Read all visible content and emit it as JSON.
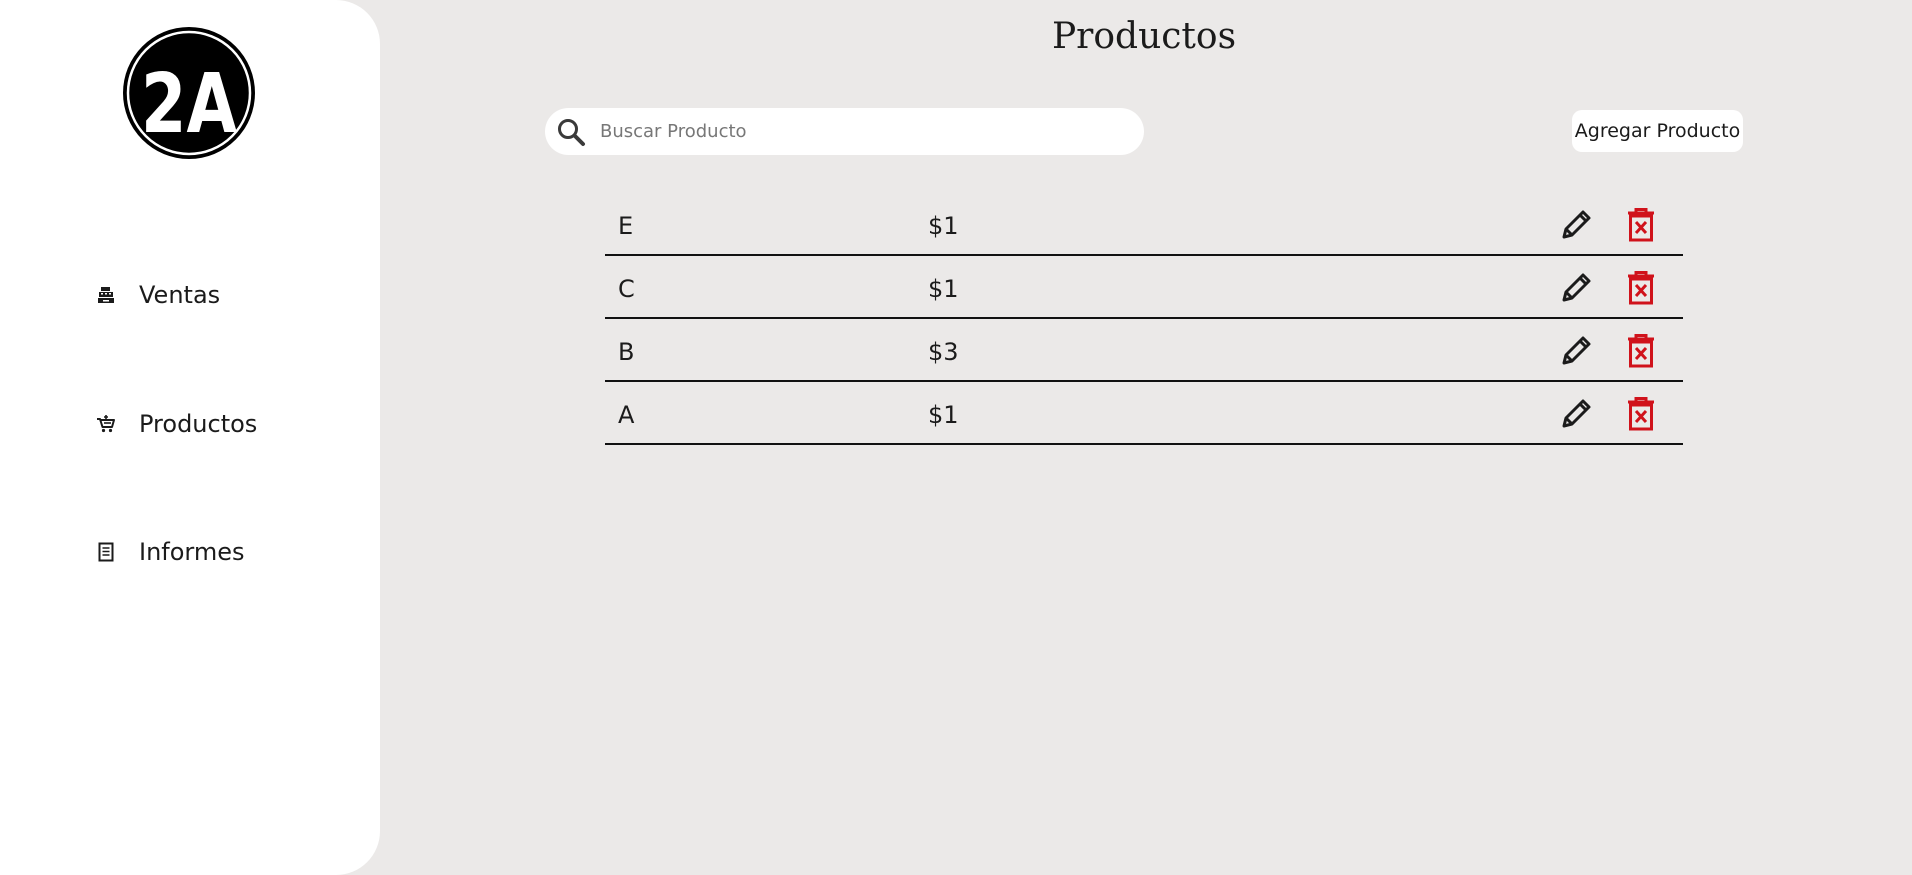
{
  "logo": {
    "text": "2A"
  },
  "sidebar": {
    "items": [
      {
        "label": "Ventas",
        "icon": "cash-register-icon"
      },
      {
        "label": "Productos",
        "icon": "cart-icon"
      },
      {
        "label": "Informes",
        "icon": "report-icon"
      }
    ]
  },
  "header": {
    "title": "Productos"
  },
  "search": {
    "placeholder": "Buscar Producto",
    "value": ""
  },
  "toolbar": {
    "add_label": "Agregar Producto"
  },
  "products": [
    {
      "name": "E",
      "price": "$1"
    },
    {
      "name": "C",
      "price": "$1"
    },
    {
      "name": "B",
      "price": "$3"
    },
    {
      "name": "A",
      "price": "$1"
    }
  ],
  "colors": {
    "background": "#ebe9e8",
    "sidebar": "#ffffff",
    "text": "#1b1b1b",
    "delete": "#d0121b"
  }
}
